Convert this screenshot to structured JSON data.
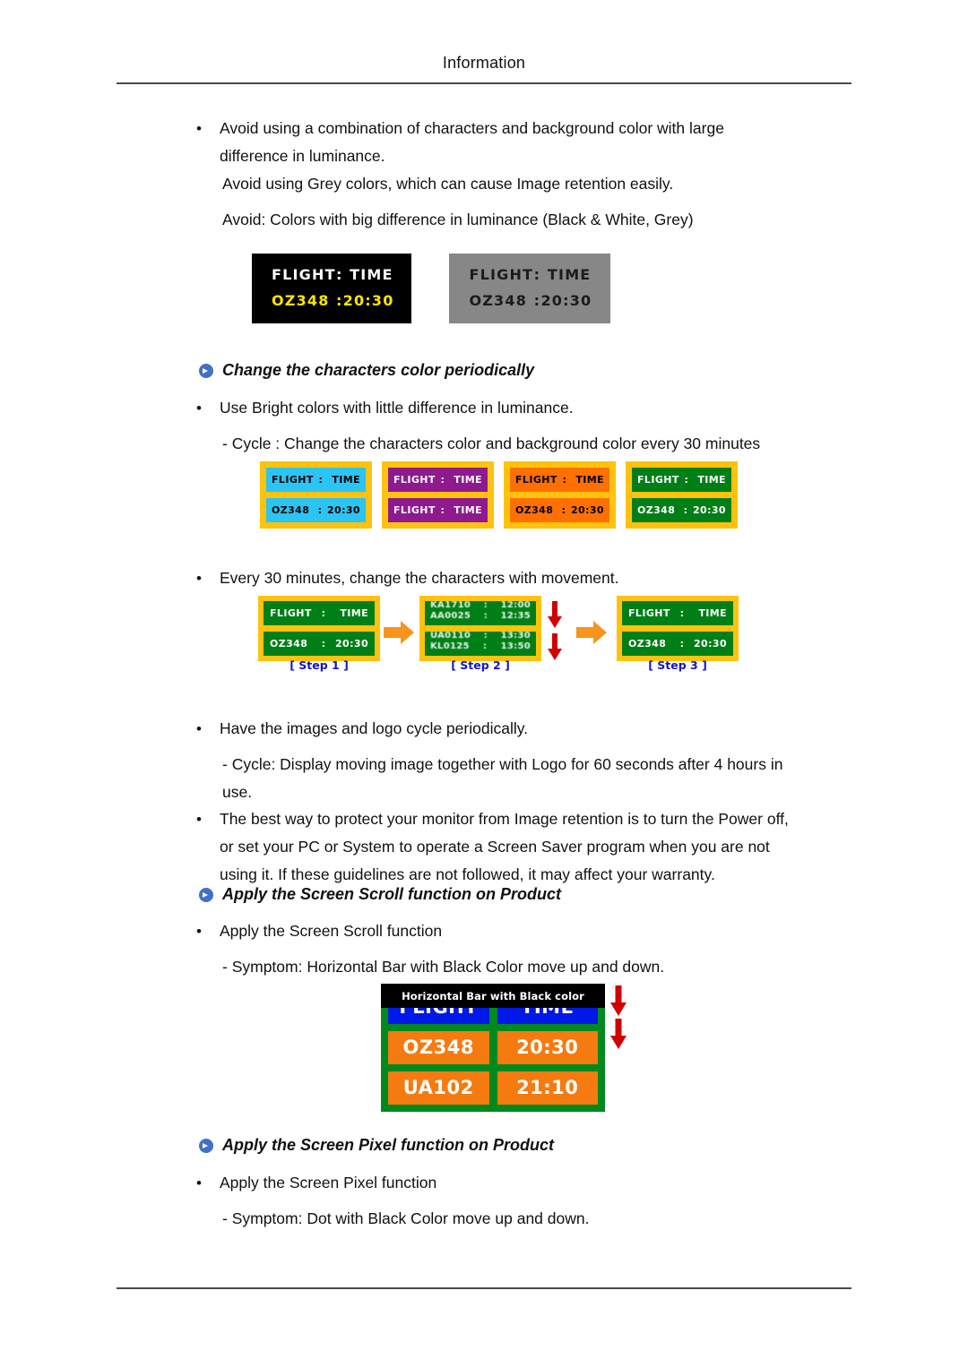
{
  "header": {
    "title": "Information"
  },
  "body": {
    "b1": "Avoid using a combination of characters and background color with large difference in luminance.",
    "b1b": "Avoid using Grey colors, which can cause Image retention easily.",
    "b1c": "Avoid: Colors with big difference in luminance (Black & White, Grey)",
    "bullet_char": "•",
    "dash_char": "-"
  },
  "sections": [
    {
      "icon": "arrow-circle-icon",
      "label": "Change the characters color periodically"
    },
    {
      "icon": "arrow-circle-icon",
      "label": "Apply the Screen Scroll function on Product"
    },
    {
      "icon": "arrow-circle-icon",
      "label": "Apply the Screen Pixel function on Product"
    }
  ],
  "section1": {
    "bullet": "Use Bright colors with little difference in luminance.",
    "sub": "- Cycle : Change the characters color and background color every 30 minutes",
    "bullet2": "Every 30 minutes, change the characters with movement.",
    "bullet3": "Have the images and logo cycle periodically.",
    "sub3": "- Cycle: Display moving image together with Logo for 60 seconds after 4 hours in use.",
    "bullet4": "The best way to protect your monitor from Image retention is to turn the Power off, or set your PC or System to operate a Screen Saver program when you are not using it. If these guidelines are not followed, it may affect your warranty."
  },
  "section2": {
    "bullet": "Apply the Screen Scroll function",
    "sub": "- Symptom: Horizontal Bar with Black Color move up and down."
  },
  "section3": {
    "bullet": "Apply the Screen Pixel function",
    "sub": "- Symptom: Dot with Black Color move up and down."
  },
  "figure_contrast": {
    "boards": [
      {
        "style": "black",
        "rows": [
          {
            "left": "FLIGHT",
            "sep": ":",
            "right": "TIME"
          },
          {
            "left": "OZ348",
            "sep": ":",
            "right": "20:30"
          }
        ]
      },
      {
        "style": "grey",
        "rows": [
          {
            "left": "FLIGHT",
            "sep": ":",
            "right": "TIME"
          },
          {
            "left": "OZ348",
            "sep": ":",
            "right": "20:30"
          }
        ]
      }
    ],
    "colors": {
      "black_bg": "#000000",
      "black_row1_text": "#ffffff",
      "black_row2_text": "#ffe400",
      "grey_bg": "#878787",
      "grey_text": "#1b1b1b"
    }
  },
  "figure_cycle": {
    "border_color": "#ffc20e",
    "panels": [
      {
        "name": "cyan-panel",
        "bg": "#2bc4f3",
        "text": "#000000",
        "rows": [
          {
            "left": "FLIGHT",
            "sep": ":",
            "right": "TIME"
          },
          {
            "left": "OZ348",
            "sep": ":",
            "right": "20:30"
          }
        ]
      },
      {
        "name": "purple-panel",
        "bg": "#8e1a8e",
        "text": "#ffffff",
        "rows": [
          {
            "left": "FLIGHT",
            "sep": ":",
            "right": "TIME"
          },
          {
            "left": "FLIGHT",
            "sep": ":",
            "right": "TIME"
          }
        ]
      },
      {
        "name": "orange-panel",
        "bg": "#ff7000",
        "text": "#000000",
        "rows": [
          {
            "left": "FLIGHT",
            "sep": ":",
            "right": "TIME"
          },
          {
            "left": "OZ348",
            "sep": ":",
            "right": "20:30"
          }
        ]
      },
      {
        "name": "green-panel",
        "bg": "#007f17",
        "text": "#ffffff",
        "rows": [
          {
            "left": "FLIGHT",
            "sep": ":",
            "right": "TIME"
          },
          {
            "left": "OZ348",
            "sep": ":",
            "right": "20:30"
          }
        ]
      }
    ]
  },
  "figure_steps": {
    "border_color": "#ffc20e",
    "panel_bg": "#007f17",
    "caption_color": "#1414c8",
    "arrow_color": "#f7941e",
    "down_arrow_color": "#d00000",
    "stages": [
      {
        "caption": "[ Step 1 ]",
        "rows": [
          {
            "left": "FLIGHT",
            "sep": ":",
            "right": "TIME"
          },
          {
            "left": "OZ348",
            "sep": ":",
            "right": "20:30"
          }
        ]
      },
      {
        "caption": "[ Step 2 ]",
        "scroll_rows": [
          [
            {
              "left": "KA1710",
              "sep": ":",
              "right": "12:00"
            },
            {
              "left": "AA0025",
              "sep": ":",
              "right": "12:35"
            }
          ],
          [
            {
              "left": "UA0110",
              "sep": ":",
              "right": "13:30"
            },
            {
              "left": "KL0125",
              "sep": ":",
              "right": "13:50"
            }
          ]
        ]
      },
      {
        "caption": "[ Step 3 ]",
        "rows": [
          {
            "left": "FLIGHT",
            "sep": ":",
            "right": "TIME"
          },
          {
            "left": "OZ348",
            "sep": ":",
            "right": "20:30"
          }
        ]
      }
    ]
  },
  "figure_screen_scroll": {
    "overlay_label": "Horizontal Bar with Black color",
    "panel_bg": "#00891d",
    "header_cell_bg": "#0018e8",
    "data_cell_bg": "#f57b10",
    "arrow_color": "#d00000",
    "rows": [
      {
        "type": "head",
        "left": "FLIGHT",
        "right": "TIME"
      },
      {
        "type": "data",
        "left": "OZ348",
        "right": "20:30"
      },
      {
        "type": "data",
        "left": "UA102",
        "right": "21:10"
      }
    ]
  }
}
